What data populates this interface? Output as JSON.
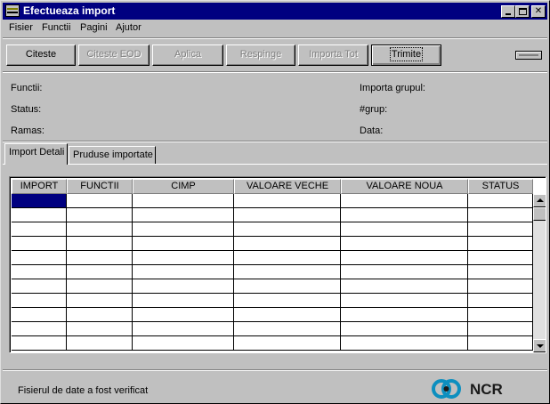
{
  "window": {
    "title": "Efectueaza import"
  },
  "menu": {
    "items": [
      {
        "label": "Fisier",
        "mnemonic": "F"
      },
      {
        "label": "Functii",
        "mnemonic": "u"
      },
      {
        "label": "Pagini",
        "mnemonic": "P"
      },
      {
        "label": "Ajutor",
        "mnemonic": "A"
      }
    ]
  },
  "toolbar": {
    "buttons": [
      {
        "label": "Citeste",
        "enabled": true
      },
      {
        "label": "Citeste EOD",
        "enabled": false
      },
      {
        "label": "Aplica",
        "enabled": false
      },
      {
        "label": "Respinge",
        "enabled": false
      },
      {
        "label": "Importa Tot",
        "enabled": false
      },
      {
        "label": "Trimite",
        "enabled": true,
        "default": true
      }
    ]
  },
  "info": {
    "functii": "Functii:",
    "status": "Status:",
    "ramas": "Ramas:",
    "importa_grupul": "Importa grupul:",
    "grup": "#grup:",
    "data": "Data:"
  },
  "tabs": [
    {
      "label": "Import Detali",
      "active": true
    },
    {
      "label": "Pruduse importate",
      "active": false
    }
  ],
  "grid": {
    "columns": [
      "IMPORT",
      "FUNCTII",
      "CIMP",
      "VALOARE VECHE",
      "VALOARE NOUA",
      "STATUS"
    ],
    "row_count": 11
  },
  "status": {
    "message": "Fisierul de date a fost verificat"
  },
  "brand": {
    "name": "NCR",
    "color": "#0d8fbf"
  },
  "colors": {
    "titlebar": "#000080",
    "face": "#c0c0c0",
    "selection": "#000080"
  }
}
